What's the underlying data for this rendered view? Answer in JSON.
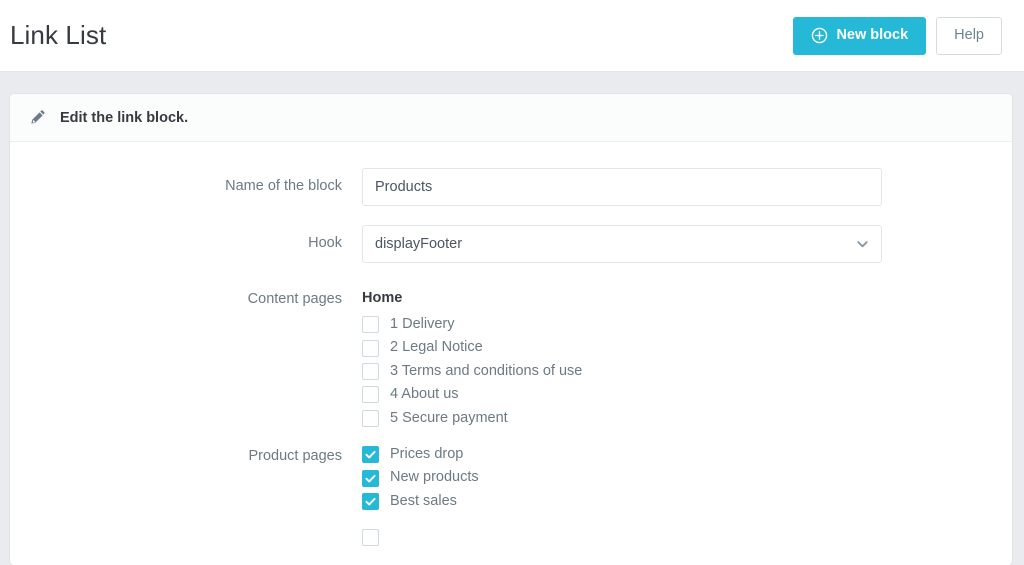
{
  "header": {
    "title": "Link List",
    "new_block_label": "New block",
    "new_block_icon": "circle-plus-icon",
    "help_label": "Help",
    "accent_color": "#25b9d7"
  },
  "panel": {
    "heading_icon": "pencil-icon",
    "heading_title": "Edit the link block."
  },
  "form": {
    "name_of_block": {
      "label": "Name of the block",
      "value": "Products",
      "placeholder": ""
    },
    "hook": {
      "label": "Hook",
      "value": "displayFooter",
      "chevron_icon": "chevron-down-icon"
    },
    "content_pages": {
      "label": "Content pages",
      "group_title": "Home",
      "items": [
        {
          "label": "1 Delivery",
          "checked": false
        },
        {
          "label": "2 Legal Notice",
          "checked": false
        },
        {
          "label": "3 Terms and conditions of use",
          "checked": false
        },
        {
          "label": "4 About us",
          "checked": false
        },
        {
          "label": "5 Secure payment",
          "checked": false
        }
      ]
    },
    "product_pages": {
      "label": "Product pages",
      "items": [
        {
          "label": "Prices drop",
          "checked": true
        },
        {
          "label": "New products",
          "checked": true
        },
        {
          "label": "Best sales",
          "checked": true
        }
      ]
    },
    "partial_next_group": {
      "items": [
        {
          "label": "",
          "checked": false
        }
      ]
    }
  }
}
